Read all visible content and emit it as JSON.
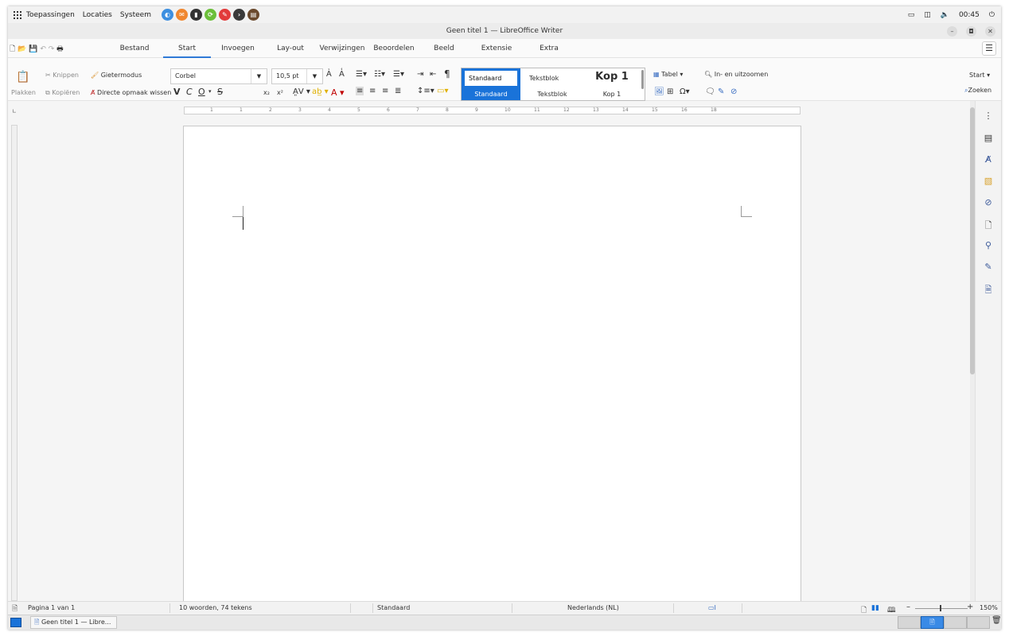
{
  "panel": {
    "menus": [
      "Toepassingen",
      "Locaties",
      "Systeem"
    ],
    "launchers": [
      {
        "name": "browser-icon",
        "color": "#3d8fe0"
      },
      {
        "name": "mail-icon",
        "color": "#f0872f"
      },
      {
        "name": "files-icon",
        "color": "#333333"
      },
      {
        "name": "sync-icon",
        "color": "#6cbf3a"
      },
      {
        "name": "tools-icon",
        "color": "#e23b3b"
      },
      {
        "name": "terminal-icon",
        "color": "#3a3a3a"
      },
      {
        "name": "archive-icon",
        "color": "#6b4a2e"
      }
    ],
    "clock": "00:45"
  },
  "window": {
    "title": "Geen titel 1 — LibreOffice Writer"
  },
  "tabs": [
    "Bestand",
    "Start",
    "Invoegen",
    "Lay-out",
    "Verwijzingen",
    "Beoordelen",
    "Beeld",
    "Extensie",
    "Extra"
  ],
  "active_tab": "Start",
  "ribbon": {
    "paste": "Plakken",
    "cut": "Knippen",
    "copy": "Kopiëren",
    "clone": "Gietermodus",
    "clear_format": "Directe opmaak wissen",
    "font_name": "Corbel",
    "font_size": "10,5 pt",
    "bold": "V",
    "italic": "C",
    "underline": "O",
    "strike": "S",
    "subscript": "x₂",
    "superscript": "x²",
    "styles": [
      {
        "preview": "Standaard",
        "name": "Standaard"
      },
      {
        "preview": "Tekstblok",
        "name": "Tekstblok"
      },
      {
        "preview": "Kop 1",
        "name": "Kop 1"
      }
    ],
    "table": "Tabel",
    "zoom": "In- en uitzoomen",
    "start_menu": "Start",
    "find": "Zoeken"
  },
  "ruler_numbers": [
    "1",
    "1",
    "2",
    "3",
    "4",
    "5",
    "6",
    "7",
    "8",
    "9",
    "10",
    "11",
    "12",
    "13",
    "14",
    "15",
    "16",
    "18"
  ],
  "status": {
    "page": "Pagina 1 van 1",
    "words": "10 woorden, 74 tekens",
    "page_style": "Standaard",
    "language": "Nederlands (NL)",
    "zoom": "150%"
  },
  "taskbar": {
    "window_label": "Geen titel 1 — Libre..."
  }
}
